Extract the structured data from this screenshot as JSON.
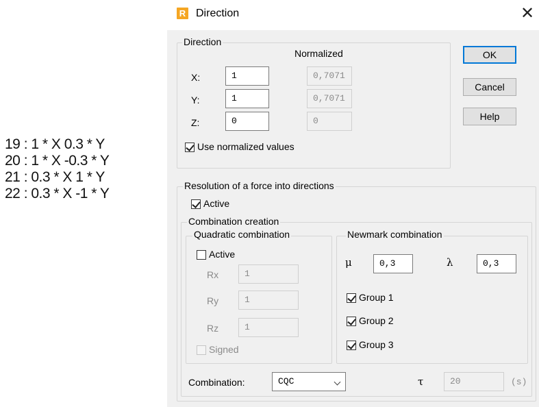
{
  "notes": [
    "19 : 1 * X  0.3 * Y",
    "20 : 1 * X  -0.3 * Y",
    "21 : 0.3 * X  1 * Y",
    "22 : 0.3 * X  -1 * Y"
  ],
  "window": {
    "title": "Direction",
    "logo_letter": "R"
  },
  "direction": {
    "group_label": "Direction",
    "normalized_label": "Normalized",
    "x_label": "X:",
    "y_label": "Y:",
    "z_label": "Z:",
    "x_value": "1",
    "y_value": "1",
    "z_value": "0",
    "x_normalized": "0,7071",
    "y_normalized": "0,7071",
    "z_normalized": "0",
    "use_normalized_label": "Use normalized values",
    "use_normalized_checked": true
  },
  "buttons": {
    "ok": "OK",
    "cancel": "Cancel",
    "help": "Help"
  },
  "resolution": {
    "group_label": "Resolution of a force into directions",
    "active_label": "Active",
    "active_checked": true,
    "combination_creation_label": "Combination creation"
  },
  "quadratic": {
    "group_label": "Quadratic combination",
    "active_label": "Active",
    "active_checked": false,
    "rx_label": "Rx",
    "ry_label": "Ry",
    "rz_label": "Rz",
    "rx_value": "1",
    "ry_value": "1",
    "rz_value": "1",
    "signed_label": "Signed",
    "signed_checked": false
  },
  "newmark": {
    "group_label": "Newmark combination",
    "mu_symbol": "μ",
    "mu_value": "0,3",
    "lambda_symbol": "λ",
    "lambda_value": "0,3",
    "group1_label": "Group 1",
    "group2_label": "Group 2",
    "group3_label": "Group 3",
    "group1_checked": true,
    "group2_checked": true,
    "group3_checked": true
  },
  "combination": {
    "label": "Combination:",
    "selected": "CQC",
    "tau_symbol": "τ",
    "tau_value": "20",
    "tau_unit": "(s)"
  }
}
